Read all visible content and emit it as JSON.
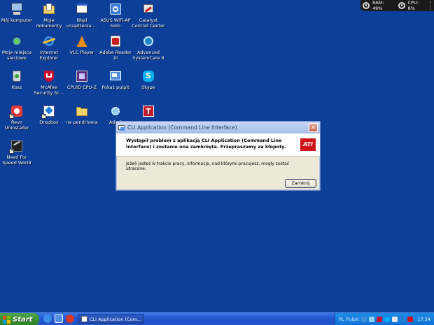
{
  "desktop": {
    "icons": [
      {
        "label": "Mój komputer"
      },
      {
        "label": "Moje dokumenty"
      },
      {
        "label": "Błąd urządzenia ..."
      },
      {
        "label": "ASUS WiFi-AP Solo"
      },
      {
        "label": "Catalyst Control Center"
      },
      {
        "label": "Moje miejsca sieciowe"
      },
      {
        "label": "Internet Explorer"
      },
      {
        "label": "VLC Player"
      },
      {
        "label": "Adobe Reader XI"
      },
      {
        "label": "Advanced SystemCare 8"
      },
      {
        "label": "Kosz"
      },
      {
        "label": "McAfee Security Sc..."
      },
      {
        "label": "CPUID CPU-Z"
      },
      {
        "label": "Pokaż pulpit"
      },
      {
        "label": "Skype"
      },
      {
        "label": "Revo Uninstaller"
      },
      {
        "label": "Dropbox"
      },
      {
        "label": "na pendrivera"
      },
      {
        "label": "AdwC"
      },
      {
        "label": ""
      },
      {
        "label": "Need For Speed World"
      }
    ]
  },
  "gadget": {
    "ram": "RAM: 49%",
    "cpu": "CPU: 8%"
  },
  "dialog": {
    "title": "CLI Application (Command Line Interface)",
    "close_label": "✕",
    "message": "Wystąpił problem z aplikacją CLI Application (Command Line Interface) i zostanie ona zamknięta. Przepraszamy za kłopoty.",
    "logo_text": "ATI",
    "detail": "Jeżeli jesteś w trakcie pracy, informacje, nad którymi pracujesz, mogły zostać utracone.",
    "button_label": "Zamknij"
  },
  "taskbar": {
    "start_label": "Start",
    "task_label": "CLI Application (Com...",
    "language": "PL",
    "desktop_label": "Pulpit",
    "clock": "17:24"
  }
}
